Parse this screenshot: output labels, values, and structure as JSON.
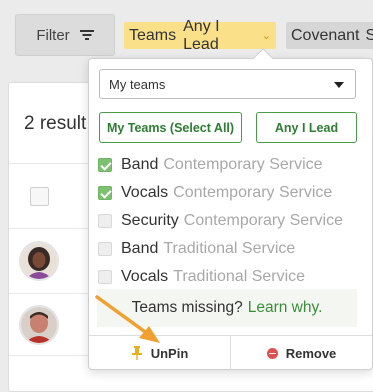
{
  "toolbar": {
    "filter_label": "Filter",
    "filter_icon": "filter-lines-icon",
    "teams_chip": {
      "label": "Teams",
      "value": "Any I Lead",
      "color": "#fbe08a"
    },
    "covenant_chip": {
      "label": "Covenant",
      "value": "S"
    }
  },
  "main": {
    "results_text": "2 result"
  },
  "popover": {
    "select": {
      "value": "My teams",
      "options_visible": [
        "My teams"
      ]
    },
    "buttons": {
      "select_all": "My Teams (Select All)",
      "any_i_lead": "Any I Lead"
    },
    "options": [
      {
        "team": "Band",
        "service": "Contemporary Service",
        "checked": true
      },
      {
        "team": "Vocals",
        "service": "Contemporary Service",
        "checked": true
      },
      {
        "team": "Security",
        "service": "Contemporary Service",
        "checked": false
      },
      {
        "team": "Band",
        "service": "Traditional Service",
        "checked": false
      },
      {
        "team": "Vocals",
        "service": "Traditional Service",
        "checked": false
      }
    ],
    "missing": {
      "text": "Teams missing?",
      "link": "Learn why."
    },
    "footer": {
      "unpin": "UnPin",
      "remove": "Remove"
    }
  },
  "colors": {
    "accent_green": "#3a8e3a",
    "check_green": "#7cc070",
    "arrow_orange": "#f0a030",
    "remove_red": "#e05050"
  }
}
